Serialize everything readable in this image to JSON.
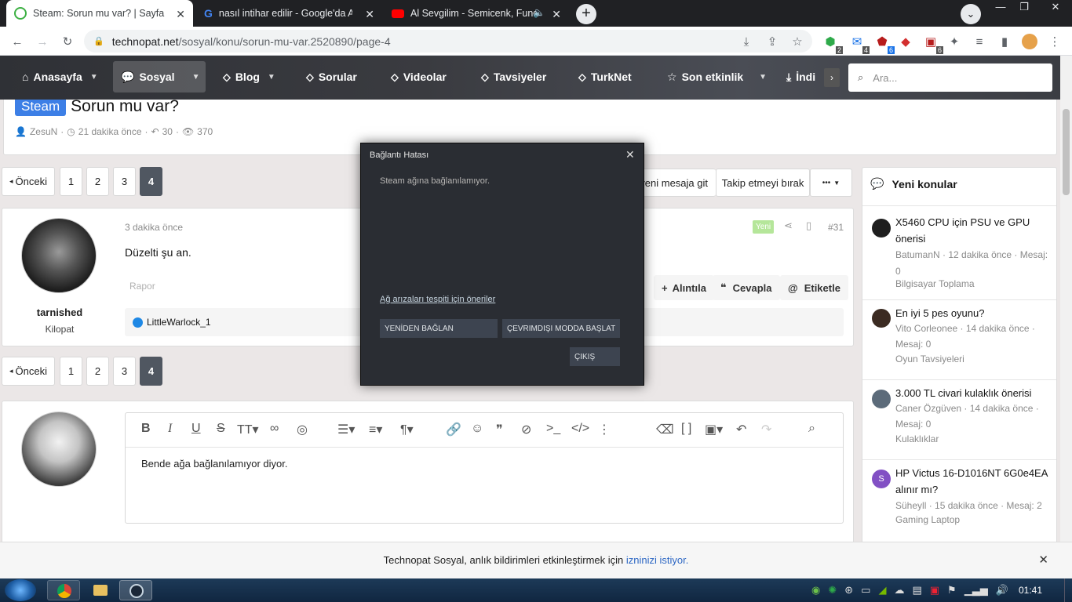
{
  "browser": {
    "tabs": [
      {
        "title": "Steam: Sorun mu var? | Sayfa 4 | T",
        "active": true
      },
      {
        "title": "nasıl intihar edilir - Google'da Ara",
        "active": false
      },
      {
        "title": "Al Sevgilim - Semicenk, Fund",
        "active": false
      }
    ],
    "url_host": "technopat.net",
    "url_path": "/sosyal/konu/sorun-mu-var.2520890/page-4",
    "ext_badges": [
      "2",
      "4",
      "6",
      "6"
    ]
  },
  "nav": {
    "items": [
      "Anasayfa",
      "Sosyal",
      "Blog",
      "Sorular",
      "Videolar",
      "Tavsiyeler",
      "TurkNet",
      "Son etkinlik",
      "İndi"
    ],
    "search_placeholder": "Ara..."
  },
  "thread": {
    "prefix": "Steam",
    "title": "Sorun mu var?",
    "author": "ZesuN",
    "time": "21 dakika önce",
    "replies": "30",
    "views": "370"
  },
  "pagination": {
    "prev": "Önceki",
    "pages": [
      "1",
      "2",
      "3",
      "4"
    ],
    "current": "4"
  },
  "thread_actions": {
    "new_msg": "yeni mesaja git",
    "unfollow": "Takip etmeyi bırak",
    "more": "•••"
  },
  "post": {
    "username": "tarnished",
    "role": "Kilopat",
    "time": "3 dakika önce",
    "badge": "Yeni",
    "number": "#31",
    "body": "Düzelti şu an.",
    "report": "Rapor",
    "quote": "Alıntıla",
    "reply": "Cevapla",
    "tag": "Etiketle",
    "likes": "LittleWarlock_1"
  },
  "editor": {
    "text": "Bende ağa bağlanılamıyor diyor."
  },
  "sidebar": {
    "title": "Yeni konular",
    "threads": [
      {
        "title": "X5460 CPU için PSU ve GPU önerisi",
        "meta": "BatumanN · 12 dakika önce · Mesaj: 0",
        "forum": "Bilgisayar Toplama"
      },
      {
        "title": "En iyi 5 pes oyunu?",
        "meta": "Vito Corleonee · 14 dakika önce · Mesaj: 0",
        "forum": "Oyun Tavsiyeleri"
      },
      {
        "title": "3.000 TL civari kulaklık önerisi",
        "meta": "Caner Özgüven · 14 dakika önce · Mesaj: 0",
        "forum": "Kulaklıklar"
      },
      {
        "title": "HP Victus 16-D1016NT 6G0e4EA alınır mı?",
        "meta": "Süheyll · 15 dakika önce · Mesaj: 2",
        "forum": "Gaming Laptop"
      }
    ],
    "avatar_letter": "S"
  },
  "notice": {
    "text": "Technopat Sosyal, anlık bildirimleri etkinleştirmek için",
    "link": "izninizi istiyor."
  },
  "dialog": {
    "title": "Bağlantı Hatası",
    "message": "Steam ağına bağlanılamıyor.",
    "link": "Ağ arızaları tespiti için öneriler",
    "reconnect": "YENİDEN BAĞLAN",
    "offline": "ÇEVRIMDIŞI MODDA BAŞLAT",
    "exit": "ÇIKIŞ"
  },
  "taskbar": {
    "clock": "01:41"
  },
  "colors": {
    "steam_prefix": "#3d7fe6",
    "current_page": "#505761",
    "dialog_bg": "#2a2d33",
    "new_badge": "#b5e69a"
  }
}
